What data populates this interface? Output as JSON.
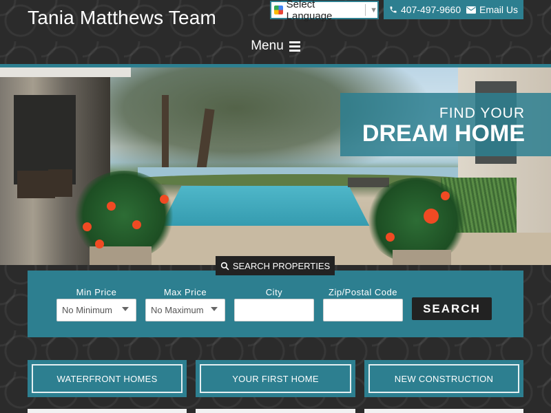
{
  "header": {
    "site_title": "Tania Matthews Team",
    "language_select": "Select Language",
    "phone": "407-497-9660",
    "email_label": "Email Us",
    "menu_label": "Menu"
  },
  "hero": {
    "line1": "FIND YOUR",
    "line2": "DREAM HOME"
  },
  "search": {
    "tab_label": "SEARCH PROPERTIES",
    "min_price_label": "Min Price",
    "min_price_value": "No Minimum",
    "max_price_label": "Max Price",
    "max_price_value": "No Maximum",
    "city_label": "City",
    "city_value": "",
    "zip_label": "Zip/Postal Code",
    "zip_value": "",
    "button_label": "SEARCH"
  },
  "categories": [
    {
      "label": "WATERFRONT HOMES"
    },
    {
      "label": "YOUR FIRST HOME"
    },
    {
      "label": "NEW CONSTRUCTION"
    }
  ],
  "colors": {
    "accent": "#2d7f90",
    "dark": "#222222"
  },
  "icons": {
    "phone": "phone-icon",
    "email": "envelope-icon",
    "menu": "hamburger-icon",
    "search": "magnifier-icon",
    "translate": "google-logo-icon"
  }
}
